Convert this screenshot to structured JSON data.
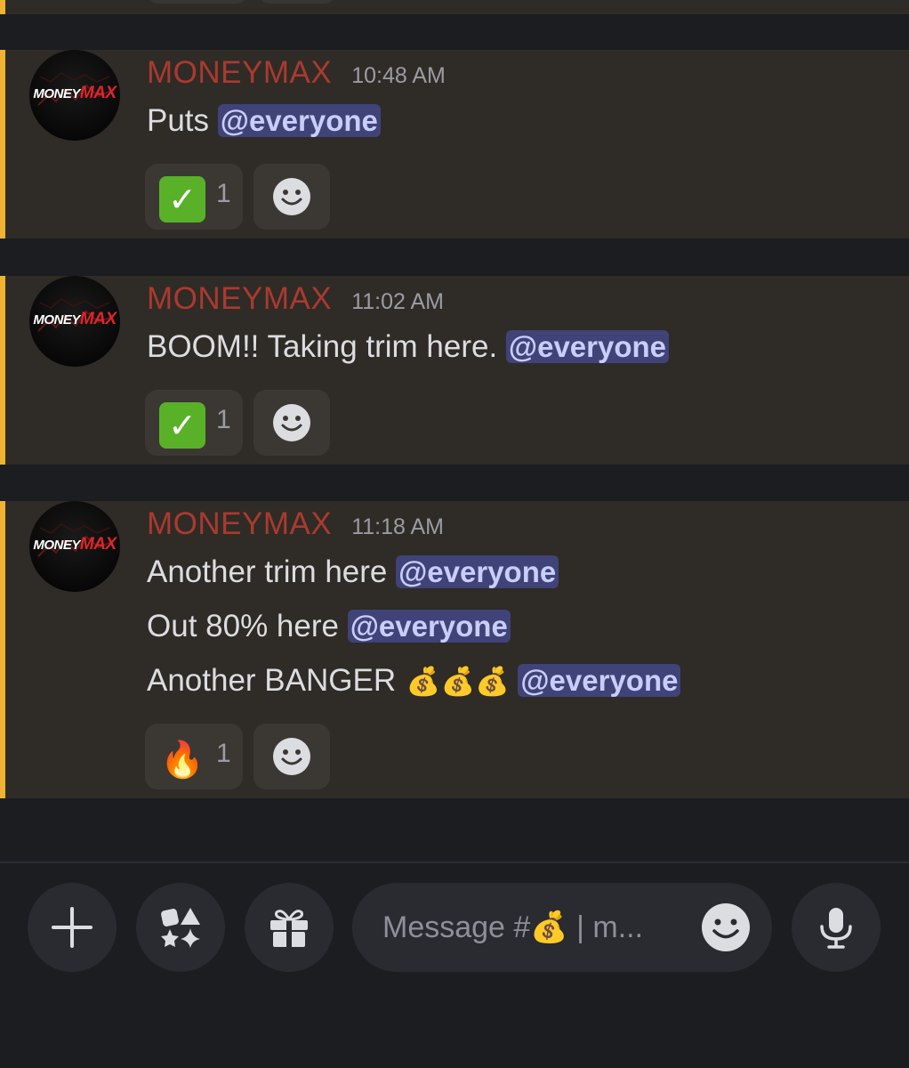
{
  "channel": {
    "messages": [
      {
        "username": "MONEYMAX",
        "timestamp": "10:48 AM",
        "lines": [
          {
            "text": "Puts ",
            "mention": "@everyone"
          }
        ],
        "reactions": [
          {
            "emoji": "white-check-mark",
            "count": "1"
          }
        ]
      },
      {
        "username": "MONEYMAX",
        "timestamp": "11:02 AM",
        "lines": [
          {
            "text": "BOOM!! Taking trim here. ",
            "mention": "@everyone"
          }
        ],
        "reactions": [
          {
            "emoji": "white-check-mark",
            "count": "1"
          }
        ]
      },
      {
        "username": "MONEYMAX",
        "timestamp": "11:18 AM",
        "lines": [
          {
            "text": "Another trim here ",
            "mention": "@everyone"
          },
          {
            "text": "Out 80% here  ",
            "mention": "@everyone"
          },
          {
            "text": "Another BANGER ",
            "emojis": "💰💰💰",
            "mention": "@everyone"
          }
        ],
        "reactions": [
          {
            "emoji": "fire",
            "count": "1"
          }
        ]
      }
    ],
    "avatar_logo": {
      "part1": "MONEY",
      "part2": "MAX"
    }
  },
  "composer": {
    "placeholder": "Message #💰 | m...",
    "buttons": [
      "plus-icon",
      "apps-icon",
      "gift-icon",
      "emoji-icon",
      "microphone-icon"
    ]
  },
  "colors": {
    "message_bg": "#2f2b26",
    "highlight_bar": "#f0b232",
    "username": "#a93a2f",
    "mention_bg": "#3f4378",
    "app_bg": "#1c1d21"
  }
}
